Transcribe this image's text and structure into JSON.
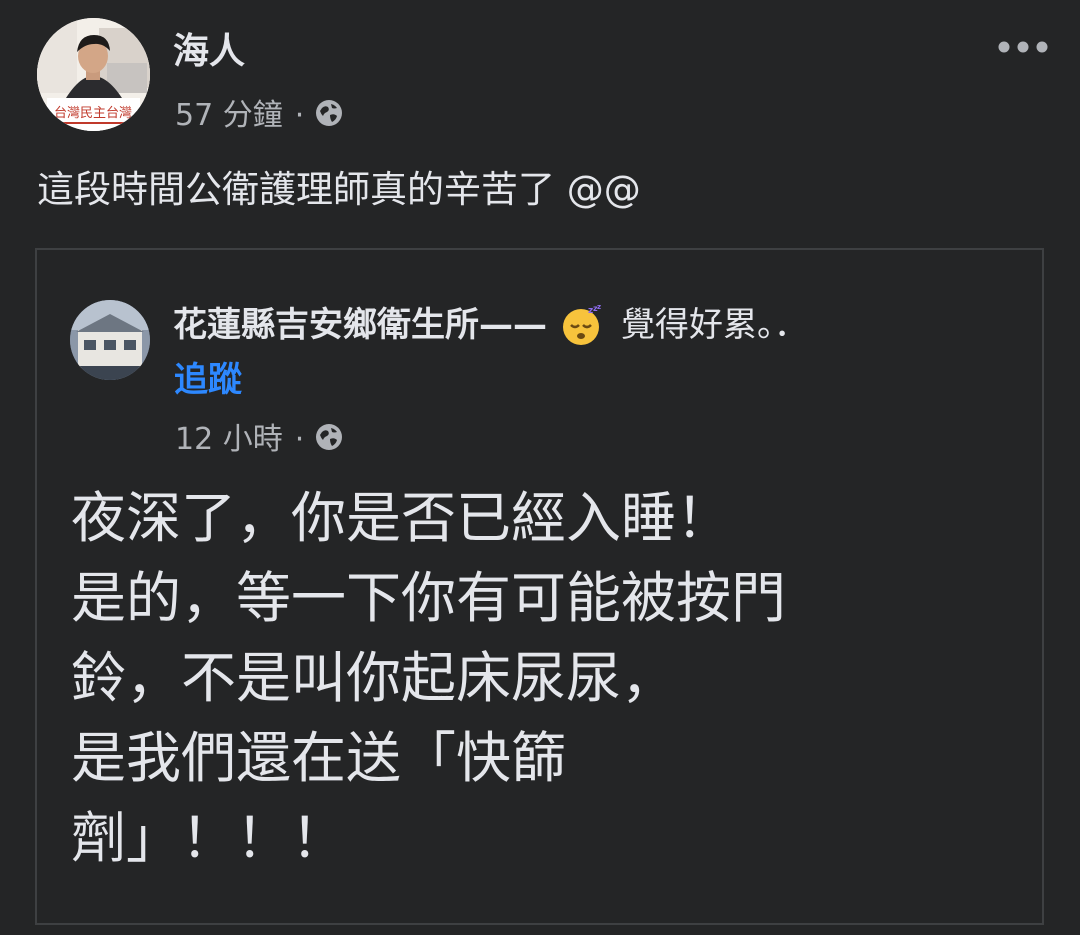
{
  "post": {
    "author": "海人",
    "time": "57 分鐘",
    "separator": "·",
    "privacy_icon": "globe-icon",
    "avatar_caption": "台灣民主台灣",
    "more_icon": "more-horizontal-icon",
    "text": "這段時間公衛護理師真的辛苦了 @@"
  },
  "shared_post": {
    "page_name": "花蓮縣吉安鄉衛生所",
    "dash": "——",
    "feeling_emoji": "sleeping-face-icon",
    "feeling": "覺得好累。．",
    "follow_label": "追蹤",
    "time": "12 小時",
    "separator": "·",
    "privacy_icon": "globe-icon",
    "lines": [
      "夜深了，你是否已經入睡！",
      "是的，等一下你有可能被按門",
      "鈴，不是叫你起床尿尿，",
      "是我們還在送「快篩",
      "劑」！！！"
    ]
  },
  "colors": {
    "background": "#242526",
    "text_primary": "#e4e6eb",
    "text_secondary": "#b0b3b8",
    "link": "#2d88ff",
    "border": "#3e4042"
  }
}
